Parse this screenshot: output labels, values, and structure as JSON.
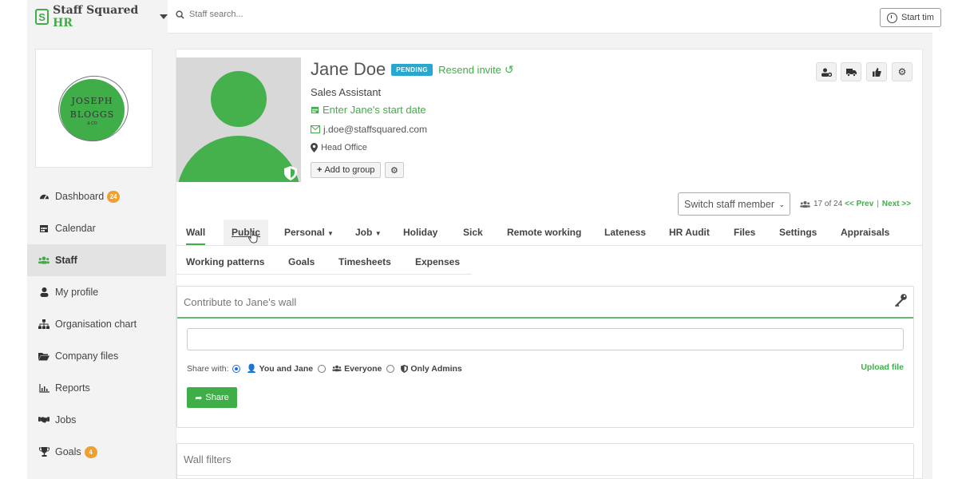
{
  "brand": {
    "name": "Staff Squared",
    "suffix": "HR"
  },
  "search": {
    "placeholder": "Staff search..."
  },
  "topbar": {
    "start_time_label": "Start tim"
  },
  "company_logo": {
    "line1": "JOSEPH",
    "line2": "BLOGGS",
    "line3": "& CO"
  },
  "sidebar": {
    "items": [
      {
        "label": "Dashboard",
        "icon": "dashboard-icon",
        "badge": "24"
      },
      {
        "label": "Calendar",
        "icon": "calendar-icon"
      },
      {
        "label": "Staff",
        "icon": "users-icon",
        "active": true
      },
      {
        "label": "My profile",
        "icon": "user-icon"
      },
      {
        "label": "Organisation chart",
        "icon": "sitemap-icon"
      },
      {
        "label": "Company files",
        "icon": "folder-icon"
      },
      {
        "label": "Reports",
        "icon": "bar-chart-icon"
      },
      {
        "label": "Jobs",
        "icon": "handshake-icon"
      },
      {
        "label": "Goals",
        "icon": "trophy-icon",
        "badge": "4"
      }
    ]
  },
  "profile": {
    "name": "Jane Doe",
    "status_badge": "PENDING",
    "resend_label": "Resend invite",
    "role": "Sales Assistant",
    "start_date_link": "Enter Jane's start date",
    "email": "j.doe@staffsquared.com",
    "location": "Head Office",
    "add_to_group_label": "Add to group"
  },
  "navigation": {
    "switch_label": "Switch staff member",
    "position": "17 of 24",
    "prev_label": "<< Prev",
    "next_label": "Next >>"
  },
  "tabs": {
    "row1": [
      "Wall",
      "Public",
      "Personal",
      "Job",
      "Holiday",
      "Sick",
      "Remote working",
      "Lateness",
      "HR Audit",
      "Files",
      "Settings",
      "Appraisals"
    ],
    "row2": [
      "Working patterns",
      "Goals",
      "Timesheets",
      "Expenses"
    ]
  },
  "wall": {
    "title": "Contribute to Jane's wall",
    "share_with_label": "Share with:",
    "options": [
      "You and Jane",
      "Everyone",
      "Only Admins"
    ],
    "upload_label": "Upload file",
    "share_button": "Share"
  },
  "filters": {
    "title": "Wall filters"
  },
  "colors": {
    "accent": "#3fae49",
    "pending": "#2aa7cf",
    "badge": "#f0a030"
  }
}
